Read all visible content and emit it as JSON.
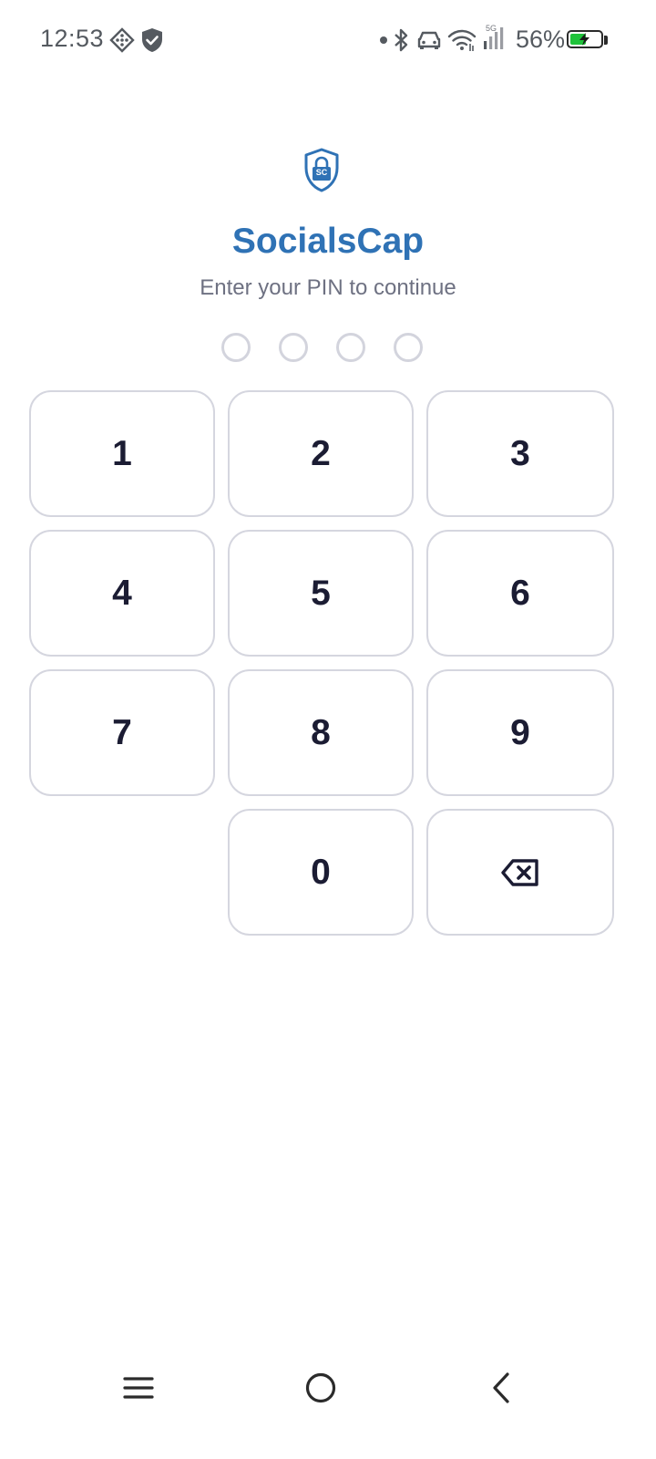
{
  "status_bar": {
    "time": "12:53",
    "battery_percent_text": "56%",
    "battery_level": 0.56,
    "icons": [
      "diamond-grid-icon",
      "shield-check-icon",
      "dot-icon",
      "bluetooth-icon",
      "car-icon",
      "wifi-icon",
      "signal-5g-icon",
      "battery-icon"
    ],
    "network_label": "5G"
  },
  "header": {
    "logo_icon": "shield-lock-icon",
    "logo_text": "SC",
    "title": "SocialsCap",
    "subtitle": "Enter your PIN to continue"
  },
  "pin": {
    "length": 4,
    "entered": 0
  },
  "keypad": {
    "keys": [
      "1",
      "2",
      "3",
      "4",
      "5",
      "6",
      "7",
      "8",
      "9",
      "0"
    ],
    "backspace_icon": "backspace-icon"
  },
  "nav_bar": {
    "icons": [
      "menu-icon",
      "home-icon",
      "back-icon"
    ]
  },
  "colors": {
    "brand": "#2f72b5",
    "key_text": "#1b1c33",
    "key_border": "#d5d6df",
    "subtitle": "#6e7182",
    "battery_fill": "#1fc23a"
  }
}
